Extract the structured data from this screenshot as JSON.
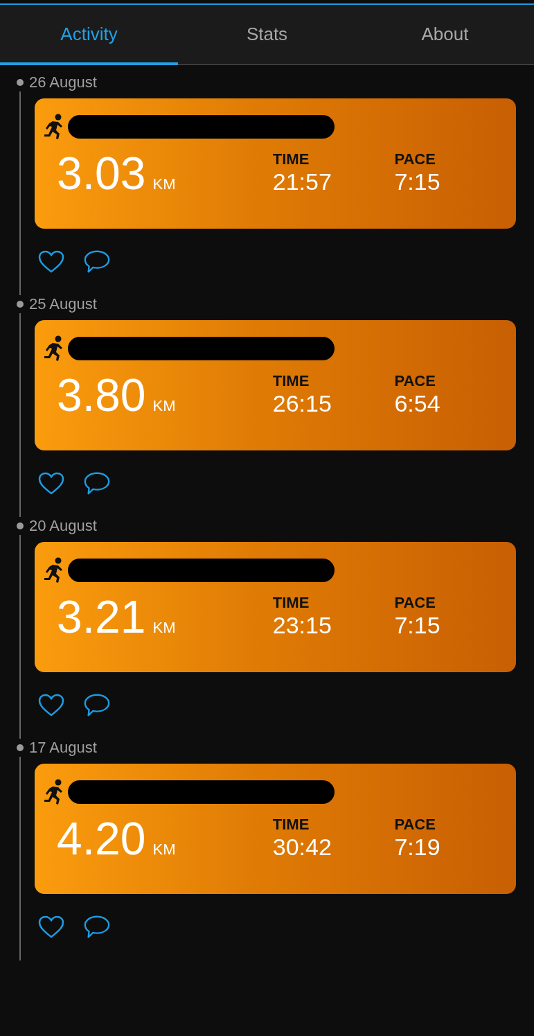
{
  "tabs": [
    {
      "label": "Activity",
      "selected": true
    },
    {
      "label": "Stats",
      "selected": false
    },
    {
      "label": "About",
      "selected": false
    }
  ],
  "activities": [
    {
      "date": "26 August",
      "distance": "3.03",
      "unit": "KM",
      "time_label": "TIME",
      "time": "21:57",
      "pace_label": "PACE",
      "pace": "7:15",
      "liked": false
    },
    {
      "date": "25 August",
      "distance": "3.80",
      "unit": "KM",
      "time_label": "TIME",
      "time": "26:15",
      "pace_label": "PACE",
      "pace": "6:54",
      "liked": false
    },
    {
      "date": "20 August",
      "distance": "3.21",
      "unit": "KM",
      "time_label": "TIME",
      "time": "23:15",
      "pace_label": "PACE",
      "pace": "7:15",
      "liked": false
    },
    {
      "date": "17 August",
      "distance": "4.20",
      "unit": "KM",
      "time_label": "TIME",
      "time": "30:42",
      "pace_label": "PACE",
      "pace": "7:19",
      "liked": false
    }
  ]
}
